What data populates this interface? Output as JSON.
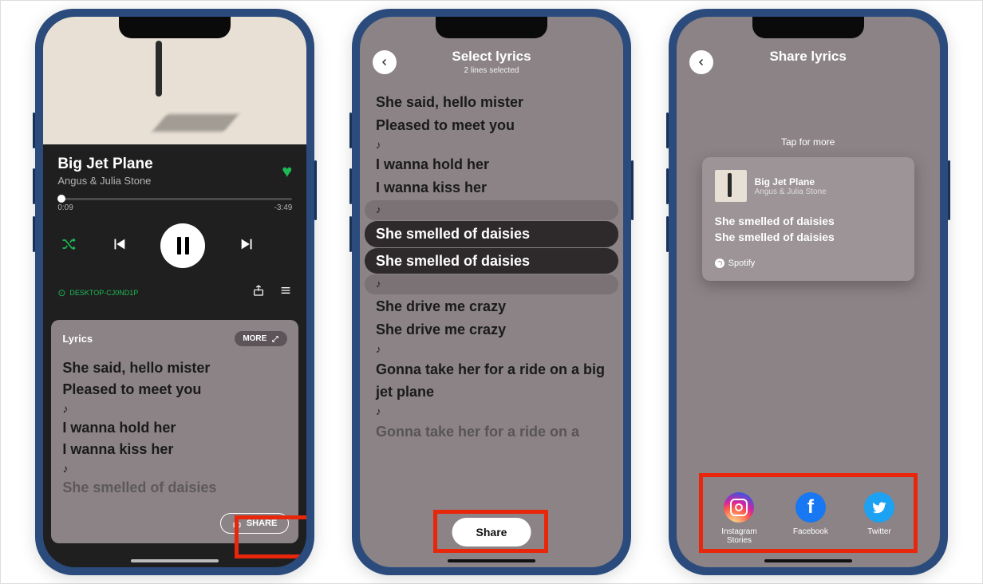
{
  "phone1": {
    "song_title": "Big Jet Plane",
    "artist": "Angus & Julia Stone",
    "time_elapsed": "0:09",
    "time_remaining": "-3:49",
    "device_name": "DESKTOP-CJ0ND1P",
    "lyrics_card": {
      "title": "Lyrics",
      "more_label": "MORE",
      "share_label": "SHARE",
      "lines": [
        "She said, hello mister",
        "Pleased to meet you",
        "♪",
        "I wanna hold her",
        "I wanna kiss her",
        "♪",
        "She smelled of daisies"
      ]
    }
  },
  "phone2": {
    "title": "Select lyrics",
    "subtitle": "2 lines selected",
    "share_label": "Share",
    "lines": [
      {
        "t": "She said, hello mister",
        "sel": false,
        "pill": false
      },
      {
        "t": "Pleased to meet you",
        "sel": false,
        "pill": false
      },
      {
        "t": "♪",
        "sel": false,
        "pill": false,
        "note": true
      },
      {
        "t": "I wanna hold her",
        "sel": false,
        "pill": false
      },
      {
        "t": "I wanna kiss her",
        "sel": false,
        "pill": false
      },
      {
        "t": "♪",
        "sel": false,
        "pill": true,
        "note": true
      },
      {
        "t": "She smelled of daisies",
        "sel": true,
        "pill": true
      },
      {
        "t": "She smelled of daisies",
        "sel": true,
        "pill": true
      },
      {
        "t": "♪",
        "sel": false,
        "pill": true,
        "note": true
      },
      {
        "t": "She drive me crazy",
        "sel": false,
        "pill": false
      },
      {
        "t": "She drive me crazy",
        "sel": false,
        "pill": false
      },
      {
        "t": "♪",
        "sel": false,
        "pill": false,
        "note": true
      },
      {
        "t": "Gonna take her for a ride on a big jet plane",
        "sel": false,
        "pill": false
      },
      {
        "t": "♪",
        "sel": false,
        "pill": false,
        "note": true
      },
      {
        "t": "Gonna take her for a ride on a",
        "sel": false,
        "pill": false,
        "faded": true
      }
    ]
  },
  "phone3": {
    "title": "Share lyrics",
    "tap_more": "Tap for more",
    "card": {
      "song_title": "Big Jet Plane",
      "artist": "Angus & Julia Stone",
      "lines": [
        "She smelled of daisies",
        "She smelled of daisies"
      ],
      "brand": "Spotify"
    },
    "targets": [
      {
        "label": "Instagram Stories",
        "kind": "ig"
      },
      {
        "label": "Facebook",
        "kind": "fb"
      },
      {
        "label": "Twitter",
        "kind": "tw"
      }
    ]
  }
}
